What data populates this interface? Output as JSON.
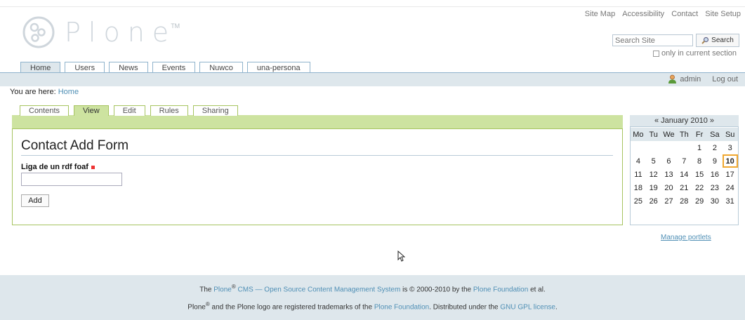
{
  "site_actions": [
    "Site Map",
    "Accessibility",
    "Contact",
    "Site Setup"
  ],
  "logo": {
    "text": "Plone",
    "tm": "TM"
  },
  "search": {
    "placeholder": "Search Site",
    "button_label": "Search",
    "current_section_label": "only in current section"
  },
  "portal_tabs": [
    {
      "label": "Home",
      "active": true
    },
    {
      "label": "Users",
      "active": false
    },
    {
      "label": "News",
      "active": false
    },
    {
      "label": "Events",
      "active": false
    },
    {
      "label": "Nuwco",
      "active": false
    },
    {
      "label": "una-persona",
      "active": false
    }
  ],
  "user": {
    "name": "admin",
    "logout_label": "Log out"
  },
  "breadcrumbs": {
    "prefix": "You are here:",
    "items": [
      "Home"
    ]
  },
  "content_tabs": [
    {
      "label": "Contents",
      "active": false
    },
    {
      "label": "View",
      "active": true
    },
    {
      "label": "Edit",
      "active": false
    },
    {
      "label": "Rules",
      "active": false
    },
    {
      "label": "Sharing",
      "active": false
    }
  ],
  "form": {
    "title": "Contact Add Form",
    "field_label": "Liga de un rdf foaf",
    "field_value": "",
    "submit_label": "Add"
  },
  "calendar": {
    "prev": "«",
    "month_label": "January 2010",
    "next": "»",
    "weekdays": [
      "Mo",
      "Tu",
      "We",
      "Th",
      "Fr",
      "Sa",
      "Su"
    ],
    "weeks": [
      [
        "",
        "",
        "",
        "",
        "1",
        "2",
        "3"
      ],
      [
        "4",
        "5",
        "6",
        "7",
        "8",
        "9",
        "10"
      ],
      [
        "11",
        "12",
        "13",
        "14",
        "15",
        "16",
        "17"
      ],
      [
        "18",
        "19",
        "20",
        "21",
        "22",
        "23",
        "24"
      ],
      [
        "25",
        "26",
        "27",
        "28",
        "29",
        "30",
        "31"
      ]
    ],
    "today": "10"
  },
  "manage_portlets_label": "Manage portlets",
  "footer": {
    "line1": {
      "the": "The",
      "plone": "Plone",
      "reg": "®",
      "cms": "CMS — Open Source Content Management System",
      "is_copyright": "is © 2000-2010 by the",
      "foundation": "Plone Foundation",
      "et_al": "et al."
    },
    "line2": {
      "plone": "Plone",
      "reg": "®",
      "text": "and the Plone logo are registered trademarks of the",
      "foundation": "Plone Foundation",
      "distributed": ". Distributed under the",
      "license": "GNU GPL license",
      "end": "."
    }
  },
  "colors": {
    "accent": "#4f8fb5",
    "green_bar": "#cde3a0",
    "blue_bar": "#dee7ec",
    "today_border": "#f0a830"
  }
}
